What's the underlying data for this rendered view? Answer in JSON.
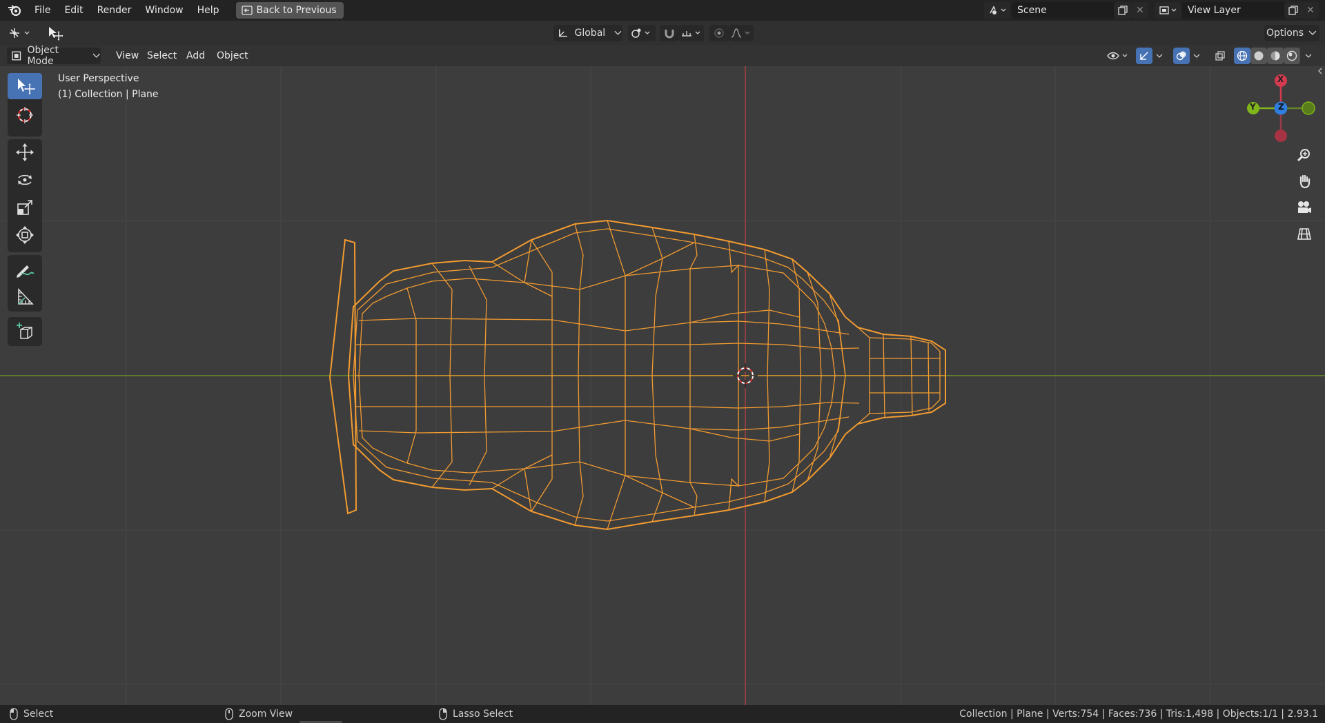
{
  "menubar": {
    "items": [
      "File",
      "Edit",
      "Render",
      "Window",
      "Help"
    ],
    "back_button": "Back to Previous",
    "scene": "Scene",
    "view_layer": "View Layer"
  },
  "toolheader": {
    "transform_orientation": "Global",
    "options_label": "Options"
  },
  "viewport_header": {
    "mode": "Object Mode",
    "menus": [
      "View",
      "Select",
      "Add",
      "Object"
    ]
  },
  "viewport": {
    "view_name": "User Perspective",
    "collection_info": "(1) Collection | Plane",
    "gizmo_axes": {
      "x": "X",
      "y": "Y",
      "z": "Z"
    }
  },
  "statusbar": {
    "left_action": "Select",
    "middle_action": "Zoom View",
    "right_action": "Lasso Select",
    "stats": "Collection | Plane | Verts:754 | Faces:736 | Tris:1,498 | Objects:1/1 | 2.93.1"
  },
  "colors": {
    "selection_orange": "#f29b30",
    "axis_x": "#d43b4f",
    "axis_y": "#7fb51a",
    "axis_z": "#2f7ee0",
    "active_tool": "#4772b3"
  }
}
